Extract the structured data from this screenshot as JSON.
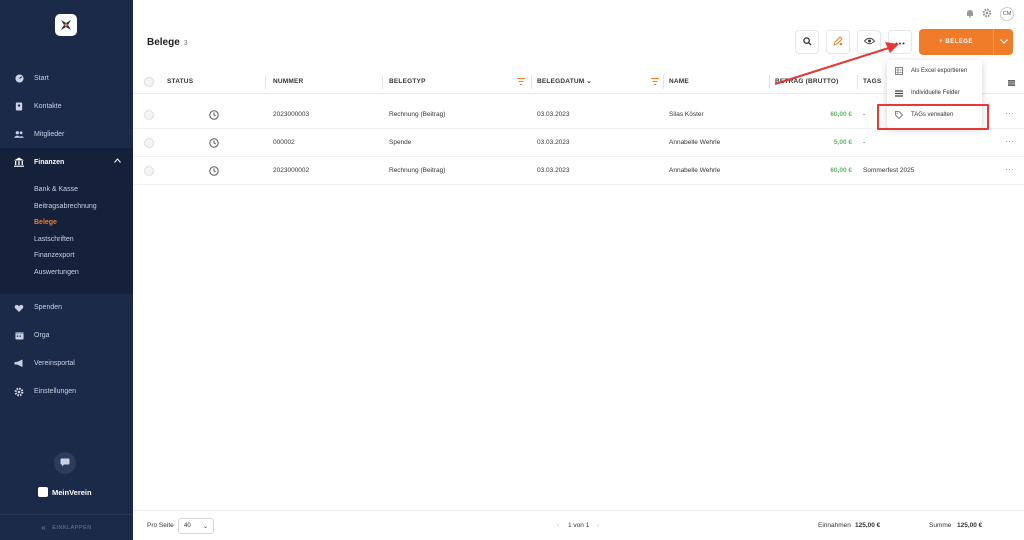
{
  "sidebar": {
    "nav": [
      {
        "label": "Start",
        "icon": "dashboard-icon"
      },
      {
        "label": "Kontakte",
        "icon": "address-book-icon"
      },
      {
        "label": "Mitglieder",
        "icon": "users-icon"
      },
      {
        "label": "Finanzen",
        "icon": "bank-icon"
      }
    ],
    "sub": [
      "Bank & Kasse",
      "Beitragsabrechnung",
      "Belege",
      "Lastschriften",
      "Finanzexport",
      "Auswertungen"
    ],
    "nav_bottom": [
      {
        "label": "Spenden",
        "icon": "donation-icon"
      },
      {
        "label": "Orga",
        "icon": "calendar-icon"
      },
      {
        "label": "Vereinsportal",
        "icon": "megaphone-icon"
      },
      {
        "label": "Einstellungen",
        "icon": "gear-icon"
      }
    ],
    "brand": "MeinVerein",
    "collapse": "EINKLAPPEN"
  },
  "topbar": {
    "avatar": "CM"
  },
  "page": {
    "title": "Belege",
    "count": "3"
  },
  "toolbar": {
    "primary_label": "+ BELEGE"
  },
  "table": {
    "headers": [
      "STATUS",
      "NUMMER",
      "BELEGTYP",
      "BELEGDATUM",
      "NAME",
      "BETRAG (BRUTTO)",
      "TAGS"
    ],
    "rows": [
      {
        "nummer": "2023000003",
        "belegtyp": "Rechnung (Beitrag)",
        "datum": "03.03.2023",
        "name": "Silas Köster",
        "betrag": "60,00 €",
        "tags": "-"
      },
      {
        "nummer": "000002",
        "belegtyp": "Spende",
        "datum": "03.03.2023",
        "name": "Annabelle Wehrle",
        "betrag": "5,00 €",
        "tags": "-"
      },
      {
        "nummer": "2023000002",
        "belegtyp": "Rechnung (Beitrag)",
        "datum": "03.03.2023",
        "name": "Annabelle Wehrle",
        "betrag": "60,00 €",
        "tags": "Sommerfest 2025"
      }
    ]
  },
  "dropdown": {
    "items": [
      "Als Excel exportieren",
      "Individuelle Felder",
      "TAGs verwalten"
    ]
  },
  "footer": {
    "per_page_label": "Pro Seite",
    "per_page_value": "40",
    "pagination": "1 von 1",
    "income_label": "Einnahmen",
    "income_value": "125,00 €",
    "sum_label": "Summe",
    "sum_value": "125,00 €"
  },
  "colors": {
    "sidebar": "#1c2a4a",
    "accent": "#f07c2a",
    "positive": "#5cb85c",
    "annotation": "#e53935"
  }
}
